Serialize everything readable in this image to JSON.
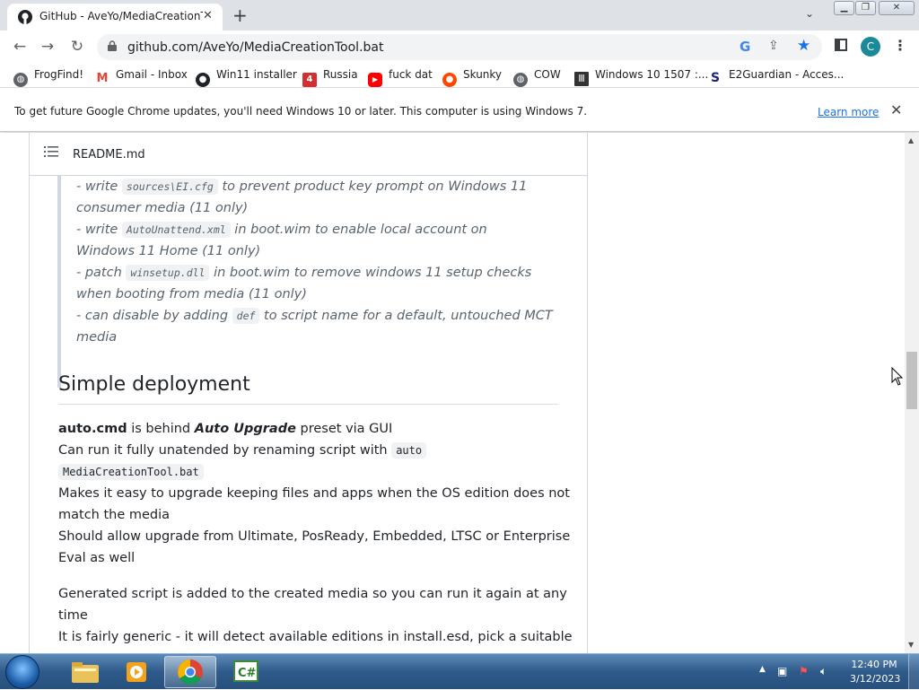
{
  "browser": {
    "tab_title": "GitHub - AveYo/MediaCreationTool.bat",
    "url": "github.com/AveYo/MediaCreationTool.bat",
    "avatar_letter": "C"
  },
  "bookmarks": [
    {
      "label": "FrogFind!",
      "icon": "globe-icon"
    },
    {
      "label": "Gmail - Inbox",
      "icon": "gmail-icon"
    },
    {
      "label": "Win11 installer",
      "icon": "github-icon"
    },
    {
      "label": "Russia",
      "icon": "bookmark-red-icon"
    },
    {
      "label": "fuck dat",
      "icon": "youtube-icon"
    },
    {
      "label": "Skunky",
      "icon": "reddit-icon"
    },
    {
      "label": "COW",
      "icon": "globe-icon"
    },
    {
      "label": "Windows 10 1507 :...",
      "icon": "archive-icon"
    },
    {
      "label": "E2Guardian - Acces...",
      "icon": "e2guardian-icon"
    }
  ],
  "infobar": {
    "message": "To get future Google Chrome updates, you'll need Windows 10 or later. This computer is using Windows 7.",
    "link": "Learn more"
  },
  "readme": {
    "filename": "README.md",
    "quote": {
      "l1_pre": "- write ",
      "l1_code": "sources\\EI.cfg",
      "l1_post": " to prevent product key prompt on Windows 11",
      "l2": "consumer media (11 only)",
      "l3_pre": "- write ",
      "l3_code": "AutoUnattend.xml",
      "l3_post": " in boot.wim to enable local account on",
      "l4": "Windows 11 Home (11 only)",
      "l5_pre": "- patch ",
      "l5_code": "winsetup.dll",
      "l5_post": " in boot.wim to remove windows 11 setup checks",
      "l6": "when booting from media (11 only)",
      "l7_pre": "- can disable by adding ",
      "l7_code": "def",
      "l7_post": " to script name for a default, untouched MCT",
      "l8": "media"
    },
    "heading": "Simple deployment",
    "p1": {
      "bold": "auto.cmd",
      "t1": " is behind ",
      "em": "Auto Upgrade",
      "t2": " preset via GUI",
      "l2_pre": "Can run it fully unatended by renaming script with ",
      "l2_code": "auto",
      "l3_code": "MediaCreationTool.bat",
      "l4": "Makes it easy to upgrade keeping files and apps when the OS edition does not",
      "l5": "match the media",
      "l6": "Should allow upgrade from Ultimate, PosReady, Embedded, LTSC or Enterprise",
      "l7": "Eval as well"
    },
    "p2": {
      "l1": "Generated script is added to the created media so you can run it again at any",
      "l2": "time",
      "l3": "It is fairly generic - it will detect available editions in install.esd, pick a suitable"
    }
  },
  "taskbar": {
    "time": "12:40 PM",
    "date": "3/12/2023"
  },
  "colors": {
    "accent": "#1a73e8",
    "avatar": "#1a8a9a"
  }
}
